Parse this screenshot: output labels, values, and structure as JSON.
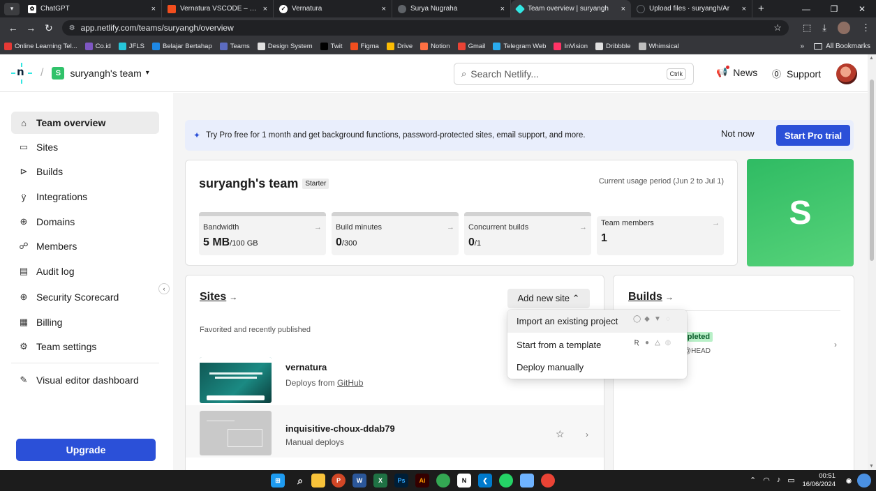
{
  "browser": {
    "tabs": [
      {
        "label": "ChatGPT",
        "icon": "chatgpt-icon"
      },
      {
        "label": "Vernatura VSCODE – Figma",
        "icon": "figma-icon"
      },
      {
        "label": "Vernatura",
        "icon": "vernatura-icon"
      },
      {
        "label": "Surya Nugraha",
        "icon": "globe-icon"
      },
      {
        "label": "Team overview | suryangh",
        "icon": "netlify-icon",
        "active": true
      },
      {
        "label": "Upload files · suryangh/Ar",
        "icon": "github-icon"
      }
    ],
    "url": "app.netlify.com/teams/suryangh/overview",
    "bookmarks": [
      {
        "label": "Online Learning Tel...",
        "color": "#e53935"
      },
      {
        "label": "Co.id",
        "color": "#7e57c2"
      },
      {
        "label": "JFLS",
        "color": "#26c6da"
      },
      {
        "label": "Belajar Bertahap",
        "color": "#1e88e5"
      },
      {
        "label": "Teams",
        "color": "#5c6bc0"
      },
      {
        "label": "Design System",
        "color": "#e0e0e0"
      },
      {
        "label": "Twit",
        "color": "#000000"
      },
      {
        "label": "Figma",
        "color": "#f24e1e"
      },
      {
        "label": "Drive",
        "color": "#fbbc04"
      },
      {
        "label": "Notion",
        "color": "#ff7043"
      },
      {
        "label": "Gmail",
        "color": "#ea4335"
      },
      {
        "label": "Telegram Web",
        "color": "#2aabee"
      },
      {
        "label": "InVision",
        "color": "#ff3366"
      },
      {
        "label": "Dribbble",
        "color": "#e0e0e0"
      },
      {
        "label": "Whimsical",
        "color": "#bdbdbd"
      }
    ],
    "more_bookmarks": "»",
    "all_bookmarks": "All Bookmarks"
  },
  "header": {
    "team_badge": "S",
    "team_name": "suryangh's team",
    "search_placeholder": "Search Netlify...",
    "search_shortcut": "Ctrlk",
    "news": "News",
    "support": "Support"
  },
  "sidebar": {
    "items": [
      {
        "label": "Team overview",
        "icon": "home-icon",
        "active": true
      },
      {
        "label": "Sites",
        "icon": "sites-icon"
      },
      {
        "label": "Builds",
        "icon": "builds-icon"
      },
      {
        "label": "Integrations",
        "icon": "integrations-icon"
      },
      {
        "label": "Domains",
        "icon": "globe-icon"
      },
      {
        "label": "Members",
        "icon": "members-icon"
      },
      {
        "label": "Audit log",
        "icon": "audit-log-icon"
      },
      {
        "label": "Security Scorecard",
        "icon": "shield-icon"
      },
      {
        "label": "Billing",
        "icon": "billing-icon"
      },
      {
        "label": "Team settings",
        "icon": "gear-icon"
      },
      {
        "label": "Visual editor dashboard",
        "icon": "pencil-icon"
      }
    ],
    "upgrade": "Upgrade"
  },
  "promo": {
    "text": "Try Pro free for 1 month and get background functions, password-protected sites, email support, and more.",
    "not_now": "Not now",
    "start_trial": "Start Pro trial"
  },
  "team_card": {
    "name": "suryangh's team",
    "plan": "Starter",
    "period": "Current usage period (Jun 2 to Jul 1)",
    "avatar_letter": "S",
    "usage": [
      {
        "label": "Bandwidth",
        "value": "5 MB",
        "limit": "/100 GB"
      },
      {
        "label": "Build minutes",
        "value": "0",
        "limit": "/300"
      },
      {
        "label": "Concurrent builds",
        "value": "0",
        "limit": "/1"
      },
      {
        "label": "Team members",
        "value": "1",
        "limit": ""
      }
    ]
  },
  "sites": {
    "title": "Sites",
    "add_new": "Add new site",
    "subtitle": "Favorited and recently published",
    "list": [
      {
        "name": "vernatura",
        "deploy_prefix": "Deploys from ",
        "deploy_source": "GitHub"
      },
      {
        "name": "inquisitive-choux-ddab79",
        "deploy_prefix": "Manual deploys",
        "deploy_source": ""
      }
    ]
  },
  "builds": {
    "title": "Builds",
    "status": "npleted",
    "ref": "@HEAD"
  },
  "add_site_menu": {
    "items": [
      {
        "label": "Import an existing project"
      },
      {
        "label": "Start from a template"
      },
      {
        "label": "Deploy manually"
      }
    ]
  },
  "taskbar": {
    "clock_time": "00:51",
    "clock_date": "16/06/2024"
  }
}
